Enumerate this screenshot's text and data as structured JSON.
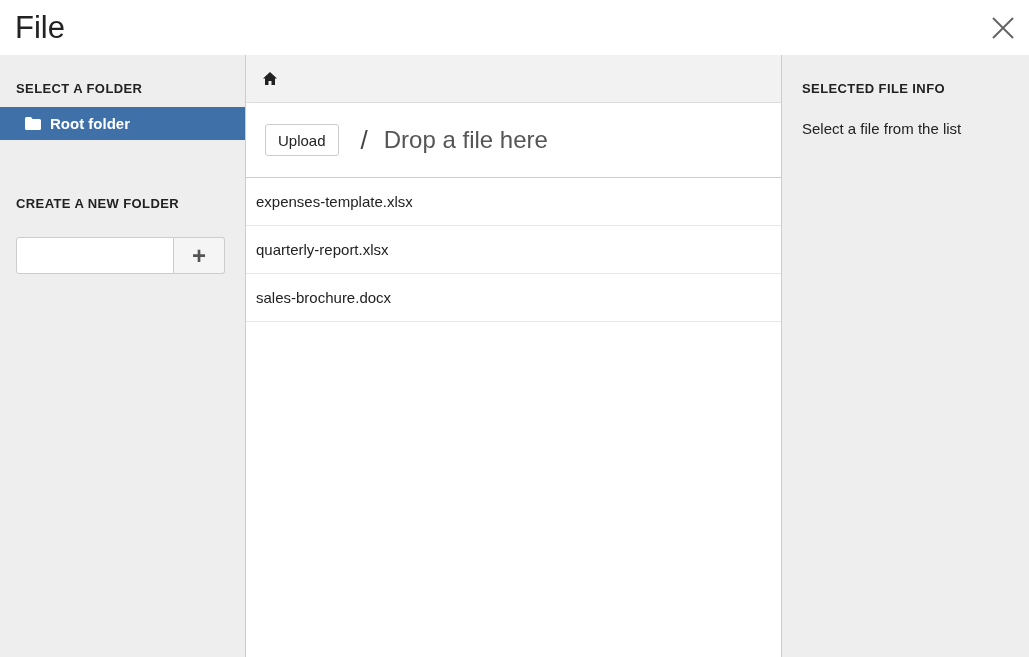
{
  "window": {
    "title": "File"
  },
  "sidebar": {
    "heading": "SELECT A FOLDER",
    "folders": [
      {
        "label": "Root folder",
        "selected": true
      }
    ],
    "new_folder": {
      "heading": "CREATE A NEW FOLDER",
      "add_button": "+"
    }
  },
  "toolbar": {
    "upload_button": "Upload",
    "separator": "/",
    "drop_hint": "Drop a file here"
  },
  "files": [
    {
      "name": "expenses-template.xlsx"
    },
    {
      "name": "quarterly-report.xlsx"
    },
    {
      "name": "sales-brochure.docx"
    }
  ],
  "info": {
    "heading": "SELECTED FILE INFO",
    "message": "Select a file from the list"
  }
}
